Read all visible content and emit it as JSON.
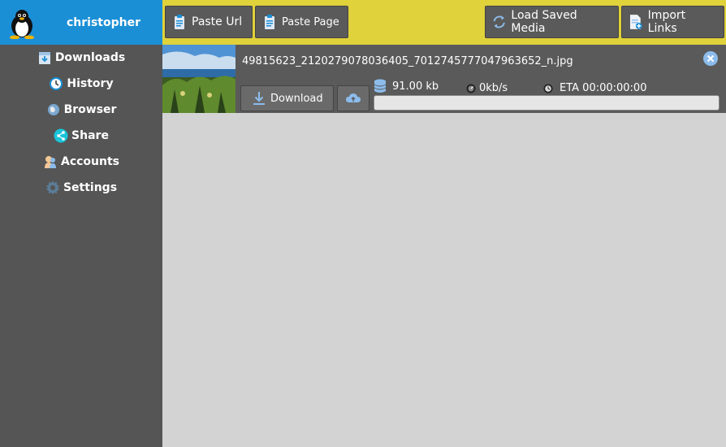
{
  "user": {
    "name": "christopher"
  },
  "sidebar": {
    "items": [
      {
        "label": "Downloads"
      },
      {
        "label": "History"
      },
      {
        "label": "Browser"
      },
      {
        "label": "Share"
      },
      {
        "label": "Accounts"
      },
      {
        "label": "Settings"
      }
    ]
  },
  "toolbar": {
    "paste_url": "Paste Url",
    "paste_page": "Paste Page",
    "load_saved_media": "Load Saved Media",
    "import_links": "Import Links"
  },
  "download_item": {
    "filename": "49815623_2120279078036405_7012745777047963652_n.jpg",
    "download_label": "Download",
    "size": "91.00 kb",
    "speed": "0kb/s",
    "eta": "ETA 00:00:00:00",
    "progress": 0
  },
  "colors": {
    "accent": "#1b8fd6",
    "toolbar": "#e0d23a",
    "sidebar": "#555555",
    "content": "#d3d3d3"
  }
}
